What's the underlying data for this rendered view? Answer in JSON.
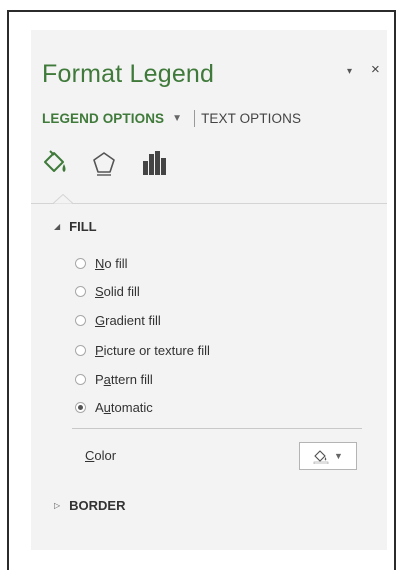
{
  "pane": {
    "title": "Format Legend",
    "dropdown_glyph": "▾",
    "close_glyph": "×"
  },
  "tabs": {
    "legend_options": "LEGEND OPTIONS",
    "caret": "▼",
    "text_options": "TEXT OPTIONS"
  },
  "icon_tabs": [
    {
      "name": "fill-line-icon",
      "active": true
    },
    {
      "name": "effects-pentagon-icon",
      "active": false
    },
    {
      "name": "legend-options-bar-icon",
      "active": false
    }
  ],
  "fill": {
    "heading": "FILL",
    "expanded_glyph": "◢",
    "options": [
      {
        "pre": "",
        "key": "N",
        "post": "o fill",
        "selected": false
      },
      {
        "pre": "",
        "key": "S",
        "post": "olid fill",
        "selected": false
      },
      {
        "pre": "",
        "key": "G",
        "post": "radient fill",
        "selected": false
      },
      {
        "pre": "",
        "key": "P",
        "post": "icture or texture fill",
        "selected": false
      },
      {
        "pre": "P",
        "key": "a",
        "post": "ttern fill",
        "selected": false
      },
      {
        "pre": "A",
        "key": "u",
        "post": "tomatic",
        "selected": true
      }
    ],
    "color_label_key": "C",
    "color_label_rest": "olor"
  },
  "border": {
    "heading": "BORDER",
    "collapsed_glyph": "▷"
  },
  "colors": {
    "accent": "#3f7a3a",
    "panel_bg": "#f3f3f3"
  }
}
